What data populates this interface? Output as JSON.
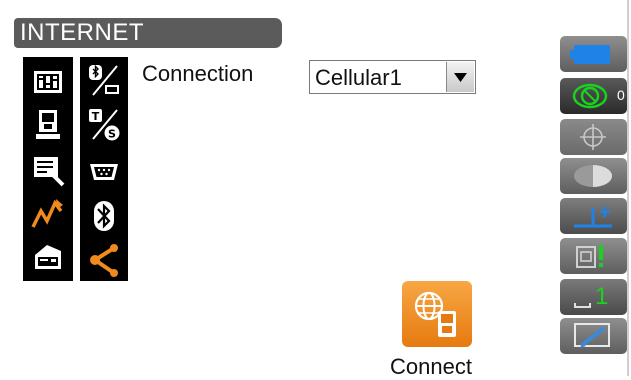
{
  "screen": {
    "title": "INTERNET",
    "connection_label": "Connection",
    "connection_value": "Cellular1",
    "connect_label": "Connect",
    "counter": "0",
    "level_number": "1"
  },
  "icons_left": [
    "instrument-settings-icon",
    "total-station-icon",
    "document-edit-icon",
    "signal-graph-icon",
    "printer-icon"
  ],
  "icons_middle": [
    "bluetooth-rs232-icon",
    "t-s-icon",
    "serial-port-icon",
    "bluetooth-icon",
    "share-icon"
  ],
  "right_panel": [
    "battery-icon",
    "tilt-icon",
    "target-crosshair-icon",
    "half-moon-icon",
    "height-plus-icon",
    "reflector-mode-icon",
    "ppm-one-icon",
    "keyboard-pen-icon"
  ],
  "colors": {
    "accent_orange": "#f08a1c",
    "panel_gray": "#5e5e5e",
    "battery_blue": "#1f82e6",
    "green": "#19d21f"
  }
}
